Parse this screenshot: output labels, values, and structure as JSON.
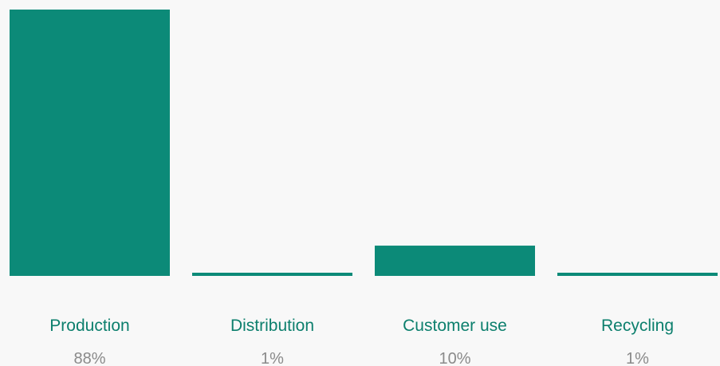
{
  "chart_data": {
    "type": "bar",
    "categories": [
      "Production",
      "Distribution",
      "Customer use",
      "Recycling"
    ],
    "values": [
      88,
      1,
      10,
      1
    ],
    "value_labels": [
      "88%",
      "1%",
      "10%",
      "1%"
    ],
    "title": "",
    "xlabel": "",
    "ylabel": "",
    "ylim": [
      0,
      88
    ],
    "grid": false,
    "bar_color": "#0c8a78",
    "label_color": "#0c7f6d",
    "value_label_color": "#8a8a8a",
    "background": "#f8f8f8"
  }
}
